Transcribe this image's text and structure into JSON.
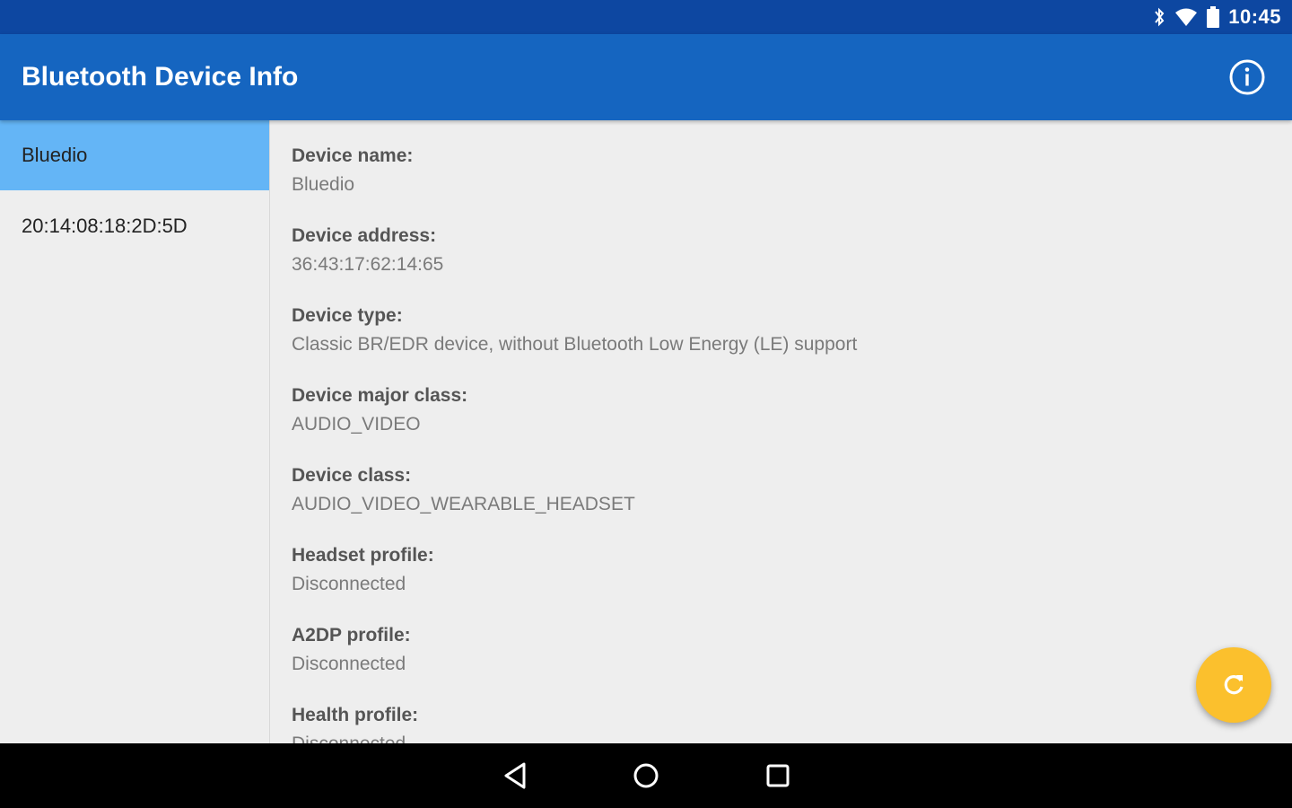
{
  "status_bar": {
    "time": "10:45",
    "icons": [
      "bluetooth-icon",
      "wifi-icon",
      "battery-icon"
    ]
  },
  "app_bar": {
    "title": "Bluetooth Device Info",
    "action_icon": "info-icon"
  },
  "sidebar": {
    "items": [
      {
        "label": "Bluedio",
        "selected": true
      },
      {
        "label": "20:14:08:18:2D:5D",
        "selected": false
      }
    ]
  },
  "details": [
    {
      "label": "Device name:",
      "value": "Bluedio"
    },
    {
      "label": "Device address:",
      "value": "36:43:17:62:14:65"
    },
    {
      "label": "Device type:",
      "value": "Classic BR/EDR device, without Bluetooth Low Energy (LE) support"
    },
    {
      "label": "Device major class:",
      "value": "AUDIO_VIDEO"
    },
    {
      "label": "Device class:",
      "value": "AUDIO_VIDEO_WEARABLE_HEADSET"
    },
    {
      "label": "Headset profile:",
      "value": "Disconnected"
    },
    {
      "label": "A2DP profile:",
      "value": "Disconnected"
    },
    {
      "label": "Health profile:",
      "value": "Disconnected"
    }
  ],
  "fab": {
    "icon": "refresh-icon"
  },
  "nav": {
    "icons": [
      "back-icon",
      "home-icon",
      "recents-icon"
    ]
  },
  "colors": {
    "status_bar": "#0d47a1",
    "app_bar": "#1565c0",
    "selected_item": "#64b5f6",
    "fab": "#fbc02d"
  }
}
